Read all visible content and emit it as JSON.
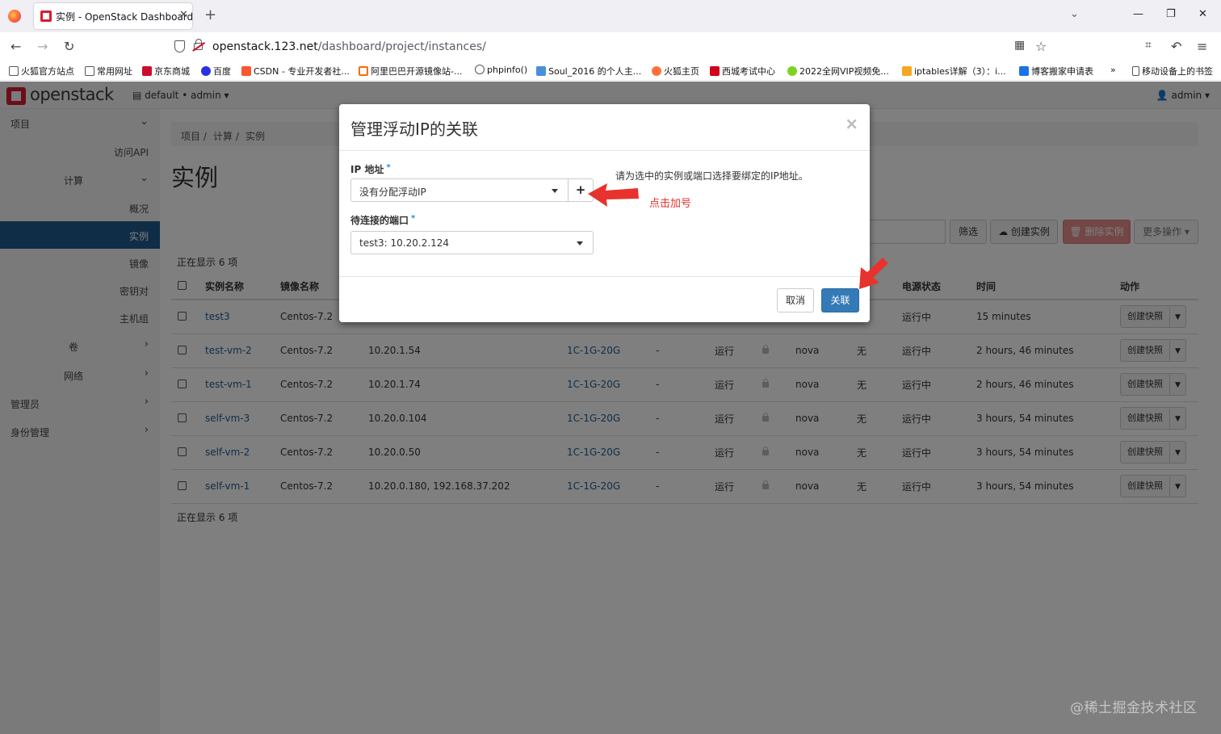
{
  "browser": {
    "tab_title": "实例 - OpenStack Dashboard",
    "url_host": "openstack.123.net",
    "url_path": "/dashboard/project/instances/",
    "url_prefix": "openstack.",
    "bookmarks": [
      "火狐官方站点",
      "常用网址",
      "京东商城",
      "百度",
      "CSDN - 专业开发者社...",
      "阿里巴巴开源镜像站-...",
      "phpinfo()",
      "Soul_2016 的个人主...",
      "火狐主页",
      "西城考试中心",
      "2022全网VIP视频免...",
      "iptables详解（3）：i...",
      "博客搬家申请表",
      "移动设备上的书签"
    ]
  },
  "header": {
    "logo": "openstack",
    "project": "default • admin",
    "user": "admin"
  },
  "sidebar": {
    "items": [
      {
        "label": "项目"
      },
      {
        "label": "访问API"
      },
      {
        "label": "计算"
      },
      {
        "label": "概况"
      },
      {
        "label": "实例"
      },
      {
        "label": "镜像"
      },
      {
        "label": "密钥对"
      },
      {
        "label": "主机组"
      },
      {
        "label": "卷"
      },
      {
        "label": "网络"
      },
      {
        "label": "管理员"
      },
      {
        "label": "身份管理"
      }
    ]
  },
  "main": {
    "breadcrumb": [
      "项目 /",
      "计算 /",
      "实例"
    ],
    "title": "实例",
    "count_text": "正在显示 6 项",
    "buttons": {
      "filter": "筛选",
      "create": "创建实例",
      "delete": "删除实例",
      "more": "更多操作 ▾"
    },
    "table": {
      "headers": [
        "实例名称",
        "镜像名称",
        "",
        "",
        "",
        "",
        "",
        "",
        "",
        "电源状态",
        "时间",
        "动作"
      ],
      "rows": [
        {
          "name": "test3",
          "image": "Centos-7.2",
          "ip": "",
          "flavor": "",
          "key": "",
          "status": "",
          "zone": "",
          "task": "",
          "power": "运行中",
          "time": "15 minutes",
          "action": "创建快照"
        },
        {
          "name": "test-vm-2",
          "image": "Centos-7.2",
          "ip": "10.20.1.54",
          "flavor": "1C-1G-20G",
          "key": "-",
          "status": "运行",
          "zone": "nova",
          "task": "无",
          "power": "运行中",
          "time": "2 hours, 46 minutes",
          "action": "创建快照"
        },
        {
          "name": "test-vm-1",
          "image": "Centos-7.2",
          "ip": "10.20.1.74",
          "flavor": "1C-1G-20G",
          "key": "-",
          "status": "运行",
          "zone": "nova",
          "task": "无",
          "power": "运行中",
          "time": "2 hours, 46 minutes",
          "action": "创建快照"
        },
        {
          "name": "self-vm-3",
          "image": "Centos-7.2",
          "ip": "10.20.0.104",
          "flavor": "1C-1G-20G",
          "key": "-",
          "status": "运行",
          "zone": "nova",
          "task": "无",
          "power": "运行中",
          "time": "3 hours, 54 minutes",
          "action": "创建快照"
        },
        {
          "name": "self-vm-2",
          "image": "Centos-7.2",
          "ip": "10.20.0.50",
          "flavor": "1C-1G-20G",
          "key": "-",
          "status": "运行",
          "zone": "nova",
          "task": "无",
          "power": "运行中",
          "time": "3 hours, 54 minutes",
          "action": "创建快照"
        },
        {
          "name": "self-vm-1",
          "image": "Centos-7.2",
          "ip": "10.20.0.180, 192.168.37.202",
          "flavor": "1C-1G-20G",
          "key": "-",
          "status": "运行",
          "zone": "nova",
          "task": "无",
          "power": "运行中",
          "time": "3 hours, 54 minutes",
          "action": "创建快照"
        }
      ]
    }
  },
  "modal": {
    "title": "管理浮动IP的关联",
    "ip_label": "IP 地址",
    "ip_value": "没有分配浮动IP",
    "port_label": "待连接的端口",
    "port_value": "test3: 10.20.2.124",
    "help": "请为选中的实例或端口选择要绑定的IP地址。",
    "cancel": "取消",
    "submit": "关联",
    "required_mark": "*"
  },
  "annotation": "点击加号",
  "watermark": "@稀土掘金技术社区",
  "colors": {
    "accent": "#1f5a8f",
    "brand": "#da1a32",
    "primary_button": "#337ab7",
    "annotation": "#e8322d"
  }
}
